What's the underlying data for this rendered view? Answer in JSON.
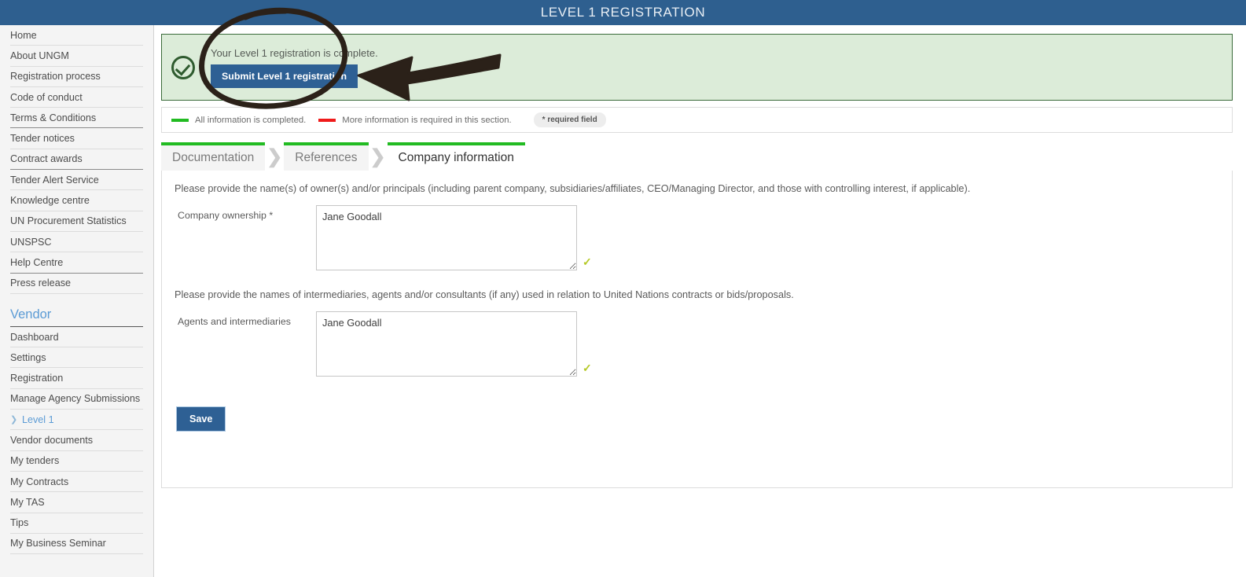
{
  "header": {
    "title": "LEVEL 1 REGISTRATION"
  },
  "sidebar": {
    "public_items": [
      {
        "label": "Home"
      },
      {
        "label": "About UNGM"
      },
      {
        "label": "Registration process"
      },
      {
        "label": "Code of conduct"
      },
      {
        "label": "Terms & Conditions"
      },
      {
        "label": "Tender notices"
      },
      {
        "label": "Contract awards"
      },
      {
        "label": "Tender Alert Service"
      },
      {
        "label": "Knowledge centre"
      },
      {
        "label": "UN Procurement Statistics"
      },
      {
        "label": "UNSPSC"
      },
      {
        "label": "Help Centre"
      },
      {
        "label": "Press release"
      }
    ],
    "vendor_heading": "Vendor",
    "vendor_items": [
      {
        "label": "Dashboard"
      },
      {
        "label": "Settings"
      },
      {
        "label": "Registration"
      },
      {
        "label": "Manage Agency Submissions"
      },
      {
        "label": "Level 1"
      },
      {
        "label": "Vendor documents"
      },
      {
        "label": "My tenders"
      },
      {
        "label": "My Contracts"
      },
      {
        "label": "My TAS"
      },
      {
        "label": "Tips"
      },
      {
        "label": "My Business Seminar"
      }
    ]
  },
  "banner": {
    "message": "Your Level 1 registration is complete.",
    "submit_label": "Submit Level 1 registration",
    "background": "#dcecd9",
    "border": "#3a6b3a"
  },
  "legend": {
    "complete_label": "All information is completed.",
    "complete_color": "#22bb22",
    "required_label": "More information is required in this section.",
    "required_color": "#ef1b1b",
    "required_field_pill": "* required field"
  },
  "tabs": [
    {
      "label": "Documentation",
      "active": false
    },
    {
      "label": "References",
      "active": false
    },
    {
      "label": "Company information",
      "active": true
    }
  ],
  "tab_separator": "❯",
  "form": {
    "ownership": {
      "instruction": "Please provide the name(s) of owner(s) and/or principals (including parent company, subsidiaries/affiliates, CEO/Managing Director, and those with controlling interest, if applicable).",
      "label": "Company ownership *",
      "value": "Jane Goodall",
      "valid_mark": "✓"
    },
    "intermediaries": {
      "instruction": "Please provide the names of intermediaries, agents and/or consultants (if any) used in relation to United Nations contracts or bids/proposals.",
      "label": "Agents and intermediaries",
      "value": "Jane Goodall",
      "valid_mark": "✓"
    },
    "save_label": "Save"
  },
  "colors": {
    "header_blue": "#2e5f8f",
    "button_blue": "#2e6094",
    "accent_green": "#22bb22",
    "link_blue": "#5b9bd5",
    "annotation": "#2b2119"
  }
}
